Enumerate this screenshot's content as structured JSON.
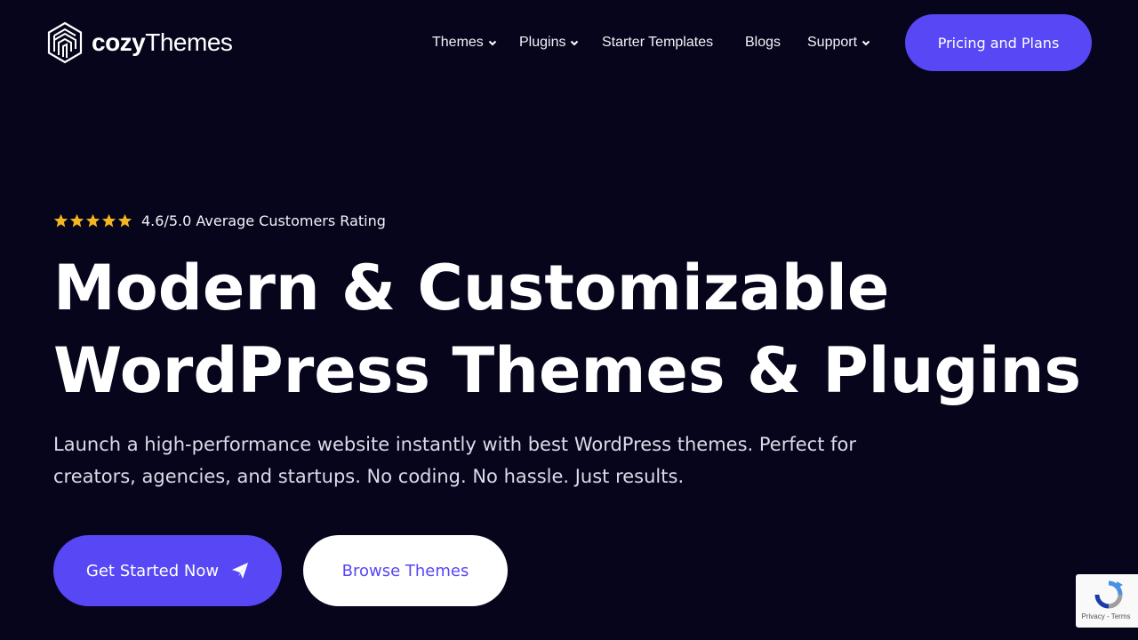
{
  "brand": {
    "name_bold": "cozy",
    "name_light": "Themes"
  },
  "nav": {
    "items": [
      {
        "label": "Themes",
        "has_dropdown": true
      },
      {
        "label": "Plugins",
        "has_dropdown": true
      },
      {
        "label": "Starter Templates",
        "has_dropdown": false
      },
      {
        "label": "Blogs",
        "has_dropdown": false
      },
      {
        "label": "Support",
        "has_dropdown": true
      }
    ],
    "cta_label": "Pricing and Plans"
  },
  "hero": {
    "rating": {
      "stars": 5,
      "text": "4.6/5.0 Average Customers Rating"
    },
    "title_line1": "Modern & Customizable",
    "title_line2": "WordPress Themes & Plugins",
    "subtitle_line1": "Launch a high-performance website instantly with best WordPress themes. Perfect for",
    "subtitle_line2": "creators, agencies, and startups. No coding. No hassle. Just results.",
    "primary_button": "Get Started Now",
    "secondary_button": "Browse Themes"
  },
  "recaptcha": {
    "privacy": "Privacy",
    "separator": " - ",
    "terms": "Terms"
  },
  "colors": {
    "background": "#07051c",
    "accent": "#5747f5",
    "star": "#f5b623",
    "text": "#ffffff"
  }
}
